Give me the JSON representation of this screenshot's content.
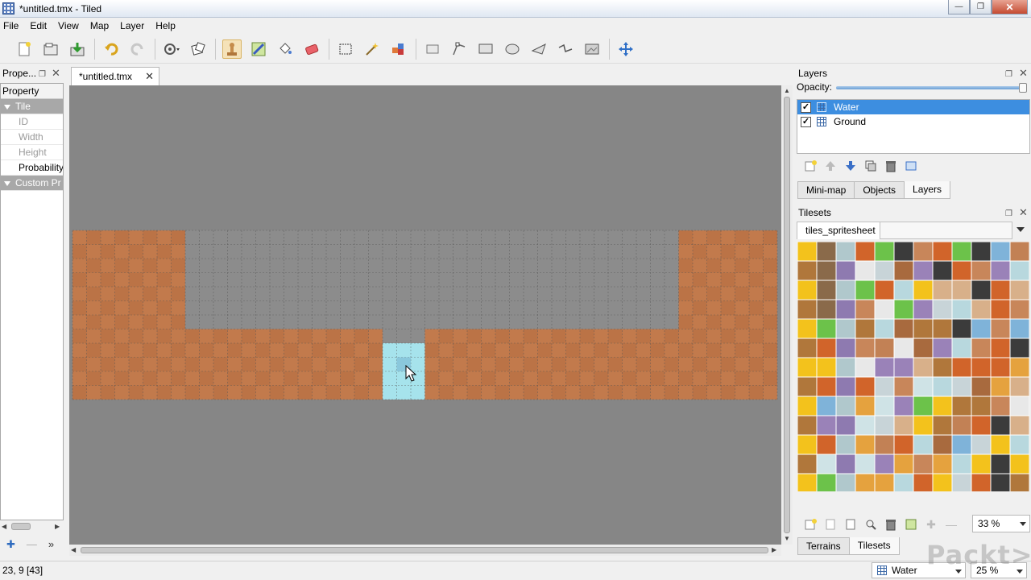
{
  "window": {
    "title": "*untitled.tmx - Tiled"
  },
  "menu": [
    "File",
    "Edit",
    "View",
    "Map",
    "Layer",
    "Help"
  ],
  "toolbar": {
    "icons": [
      "new-file-icon",
      "open-file-icon",
      "save-icon",
      "undo-icon",
      "redo-icon",
      "command-icon",
      "random-icon",
      "stamp-brush-icon",
      "terrain-brush-icon",
      "bucket-fill-icon",
      "eraser-icon",
      "rect-select-icon",
      "magic-wand-icon",
      "select-same-tile-icon",
      "select-objects-icon",
      "edit-polygons-icon",
      "insert-rectangle-icon",
      "insert-ellipse-icon",
      "insert-polygon-icon",
      "insert-polyline-icon",
      "insert-tile-icon",
      "move-icon"
    ],
    "active": "stamp-brush-icon"
  },
  "properties": {
    "title": "Prope...",
    "header": "Property",
    "groups": [
      {
        "label": "Tile",
        "items": [
          {
            "label": "ID",
            "enabled": false
          },
          {
            "label": "Width",
            "enabled": false
          },
          {
            "label": "Height",
            "enabled": false
          },
          {
            "label": "Probability",
            "enabled": true
          }
        ]
      },
      {
        "label": "Custom Pr",
        "items": []
      }
    ]
  },
  "document": {
    "tab": "*untitled.tmx"
  },
  "map": {
    "cols": 50,
    "rows": 12,
    "ground_color": "#c27a4c",
    "water_color": "#a6e3ec",
    "empty_color": "#868686",
    "cursor_tile": "23, 9"
  },
  "layers_panel": {
    "title": "Layers",
    "opacity_label": "Opacity:",
    "opacity": 1.0,
    "layers": [
      {
        "name": "Water",
        "visible": true,
        "selected": true
      },
      {
        "name": "Ground",
        "visible": true,
        "selected": false
      }
    ],
    "tabs": [
      "Mini-map",
      "Objects",
      "Layers"
    ],
    "active_tab": "Layers"
  },
  "tilesets_panel": {
    "title": "Tilesets",
    "tileset": "tiles_spritesheet",
    "zoom": "33 %",
    "tabs": [
      "Terrains",
      "Tilesets"
    ],
    "active_tab": "Tilesets"
  },
  "status": {
    "coords": "23, 9 [43]",
    "layer": "Water",
    "zoom": "25 %"
  },
  "watermark": "Packt>"
}
